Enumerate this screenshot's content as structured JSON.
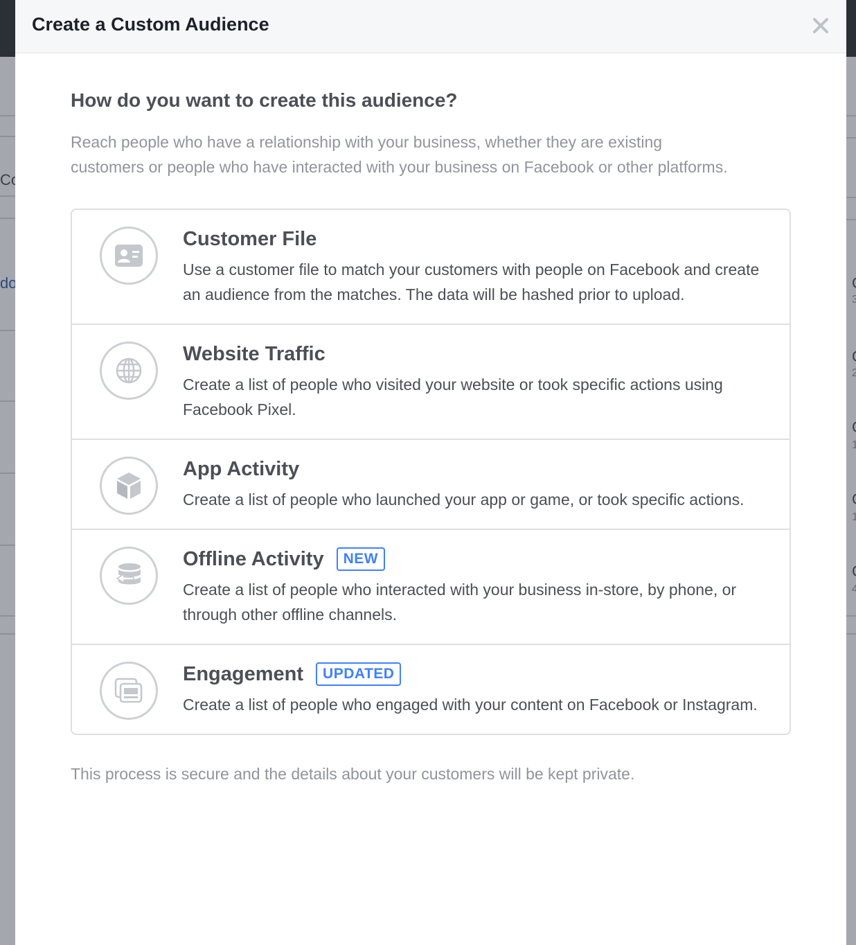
{
  "modal": {
    "title": "Create a Custom Audience",
    "question": "How do you want to create this audience?",
    "description": "Reach people who have a relationship with your business, whether they are existing customers or people who have interacted with your business on Facebook or other platforms.",
    "footer": "This process is secure and the details about your customers will be kept private."
  },
  "options": [
    {
      "icon": "contact-card-icon",
      "title": "Customer File",
      "badge": "",
      "description": "Use a customer file to match your customers with people on Facebook and create an audience from the matches. The data will be hashed prior to upload."
    },
    {
      "icon": "globe-icon",
      "title": "Website Traffic",
      "badge": "",
      "description": "Create a list of people who visited your website or took specific actions using Facebook Pixel."
    },
    {
      "icon": "cube-icon",
      "title": "App Activity",
      "badge": "",
      "description": "Create a list of people who launched your app or game, or took specific actions."
    },
    {
      "icon": "database-sync-icon",
      "title": "Offline Activity",
      "badge": "NEW",
      "description": "Create a list of people who interacted with your business in-store, by phone, or through other offline channels."
    },
    {
      "icon": "stacked-posts-icon",
      "title": "Engagement",
      "badge": "UPDATED",
      "description": "Create a list of people who engaged with your content on Facebook or Instagram."
    }
  ],
  "background": {
    "left_fragments": [
      "Co",
      "do"
    ],
    "right_fragments": [
      "C",
      "3",
      "C",
      "2",
      "C",
      "1",
      "C",
      "1",
      "C",
      "4"
    ]
  },
  "colors": {
    "badge_blue": "#4080ff",
    "icon_gray": "#cdd0d4",
    "muted_text": "#90949c",
    "primary_text": "#4b4f56"
  }
}
